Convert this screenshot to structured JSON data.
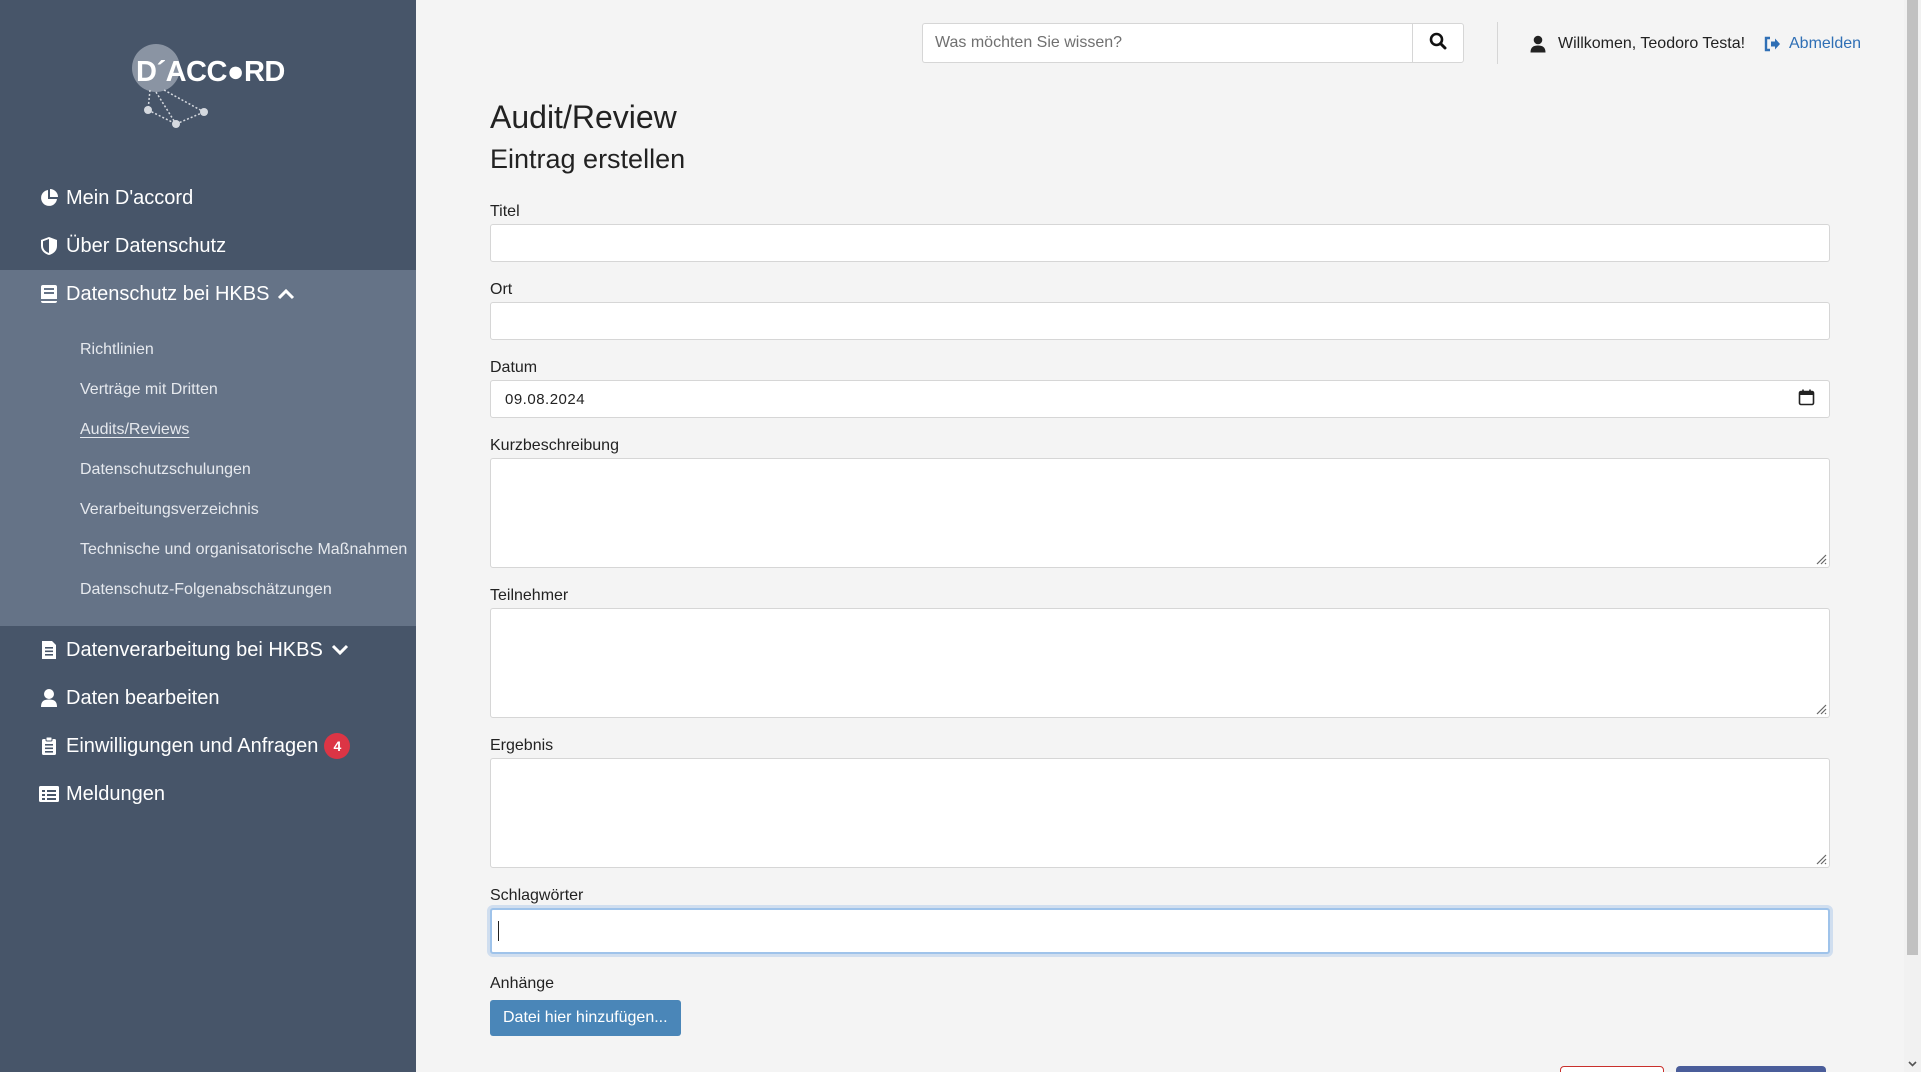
{
  "brand": {
    "logo_text": "D´ACC●RD",
    "colors": {
      "sidebar": "#475569",
      "sidebar_active": "#657387",
      "link": "#2f6fb5",
      "badge": "#dc3545",
      "upload_button": "#4a86b8"
    }
  },
  "sidebar": {
    "items": [
      {
        "label": "Mein D'accord",
        "icon": "pie-chart-icon"
      },
      {
        "label": "Über Datenschutz",
        "icon": "shield-icon"
      },
      {
        "label": "Datenschutz bei HKBS",
        "icon": "book-icon",
        "expanded": true
      },
      {
        "label": "Datenverarbeitung bei HKBS",
        "icon": "document-icon",
        "expanded": false
      },
      {
        "label": "Daten bearbeiten",
        "icon": "user-icon"
      },
      {
        "label": "Einwilligungen und Anfragen",
        "icon": "clipboard-icon",
        "badge": "4"
      },
      {
        "label": "Meldungen",
        "icon": "list-alt-icon"
      }
    ],
    "subitems": [
      "Richtlinien",
      "Verträge mit Dritten",
      "Audits/Reviews",
      "Datenschutzschulungen",
      "Verarbeitungsverzeichnis",
      "Technische und organisatorische Maßnahmen",
      "Datenschutz-Folgenabschätzungen"
    ],
    "current_subitem": "Audits/Reviews"
  },
  "header": {
    "search_placeholder": "Was möchten Sie wissen?",
    "welcome": "Willkomen, Teodoro Testa!",
    "logout": "Abmelden"
  },
  "main": {
    "title": "Audit/Review",
    "subtitle": "Eintrag erstellen",
    "fields": {
      "titel": {
        "label": "Titel",
        "value": ""
      },
      "ort": {
        "label": "Ort",
        "value": ""
      },
      "datum": {
        "label": "Datum",
        "value": "09.08.2024"
      },
      "kurzbeschreibung": {
        "label": "Kurzbeschreibung",
        "value": ""
      },
      "teilnehmer": {
        "label": "Teilnehmer",
        "value": ""
      },
      "ergebnis": {
        "label": "Ergebnis",
        "value": ""
      },
      "schlagwoerter": {
        "label": "Schlagwörter",
        "value": ""
      },
      "anhaenge": {
        "label": "Anhänge",
        "button": "Datei hier hinzufügen..."
      }
    }
  }
}
